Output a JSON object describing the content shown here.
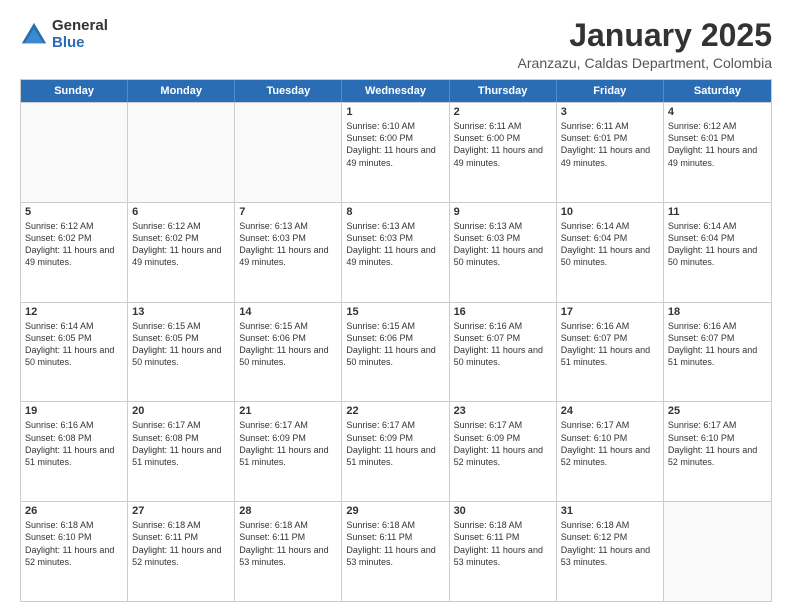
{
  "logo": {
    "general": "General",
    "blue": "Blue"
  },
  "title": "January 2025",
  "subtitle": "Aranzazu, Caldas Department, Colombia",
  "header_days": [
    "Sunday",
    "Monday",
    "Tuesday",
    "Wednesday",
    "Thursday",
    "Friday",
    "Saturday"
  ],
  "weeks": [
    [
      {
        "day": "",
        "empty": true
      },
      {
        "day": "",
        "empty": true
      },
      {
        "day": "",
        "empty": true
      },
      {
        "day": "1",
        "text": "Sunrise: 6:10 AM\nSunset: 6:00 PM\nDaylight: 11 hours\nand 49 minutes."
      },
      {
        "day": "2",
        "text": "Sunrise: 6:11 AM\nSunset: 6:00 PM\nDaylight: 11 hours\nand 49 minutes."
      },
      {
        "day": "3",
        "text": "Sunrise: 6:11 AM\nSunset: 6:01 PM\nDaylight: 11 hours\nand 49 minutes."
      },
      {
        "day": "4",
        "text": "Sunrise: 6:12 AM\nSunset: 6:01 PM\nDaylight: 11 hours\nand 49 minutes."
      }
    ],
    [
      {
        "day": "5",
        "text": "Sunrise: 6:12 AM\nSunset: 6:02 PM\nDaylight: 11 hours\nand 49 minutes."
      },
      {
        "day": "6",
        "text": "Sunrise: 6:12 AM\nSunset: 6:02 PM\nDaylight: 11 hours\nand 49 minutes."
      },
      {
        "day": "7",
        "text": "Sunrise: 6:13 AM\nSunset: 6:03 PM\nDaylight: 11 hours\nand 49 minutes."
      },
      {
        "day": "8",
        "text": "Sunrise: 6:13 AM\nSunset: 6:03 PM\nDaylight: 11 hours\nand 49 minutes."
      },
      {
        "day": "9",
        "text": "Sunrise: 6:13 AM\nSunset: 6:03 PM\nDaylight: 11 hours\nand 50 minutes."
      },
      {
        "day": "10",
        "text": "Sunrise: 6:14 AM\nSunset: 6:04 PM\nDaylight: 11 hours\nand 50 minutes."
      },
      {
        "day": "11",
        "text": "Sunrise: 6:14 AM\nSunset: 6:04 PM\nDaylight: 11 hours\nand 50 minutes."
      }
    ],
    [
      {
        "day": "12",
        "text": "Sunrise: 6:14 AM\nSunset: 6:05 PM\nDaylight: 11 hours\nand 50 minutes."
      },
      {
        "day": "13",
        "text": "Sunrise: 6:15 AM\nSunset: 6:05 PM\nDaylight: 11 hours\nand 50 minutes."
      },
      {
        "day": "14",
        "text": "Sunrise: 6:15 AM\nSunset: 6:06 PM\nDaylight: 11 hours\nand 50 minutes."
      },
      {
        "day": "15",
        "text": "Sunrise: 6:15 AM\nSunset: 6:06 PM\nDaylight: 11 hours\nand 50 minutes."
      },
      {
        "day": "16",
        "text": "Sunrise: 6:16 AM\nSunset: 6:07 PM\nDaylight: 11 hours\nand 50 minutes."
      },
      {
        "day": "17",
        "text": "Sunrise: 6:16 AM\nSunset: 6:07 PM\nDaylight: 11 hours\nand 51 minutes."
      },
      {
        "day": "18",
        "text": "Sunrise: 6:16 AM\nSunset: 6:07 PM\nDaylight: 11 hours\nand 51 minutes."
      }
    ],
    [
      {
        "day": "19",
        "text": "Sunrise: 6:16 AM\nSunset: 6:08 PM\nDaylight: 11 hours\nand 51 minutes."
      },
      {
        "day": "20",
        "text": "Sunrise: 6:17 AM\nSunset: 6:08 PM\nDaylight: 11 hours\nand 51 minutes."
      },
      {
        "day": "21",
        "text": "Sunrise: 6:17 AM\nSunset: 6:09 PM\nDaylight: 11 hours\nand 51 minutes."
      },
      {
        "day": "22",
        "text": "Sunrise: 6:17 AM\nSunset: 6:09 PM\nDaylight: 11 hours\nand 51 minutes."
      },
      {
        "day": "23",
        "text": "Sunrise: 6:17 AM\nSunset: 6:09 PM\nDaylight: 11 hours\nand 52 minutes."
      },
      {
        "day": "24",
        "text": "Sunrise: 6:17 AM\nSunset: 6:10 PM\nDaylight: 11 hours\nand 52 minutes."
      },
      {
        "day": "25",
        "text": "Sunrise: 6:17 AM\nSunset: 6:10 PM\nDaylight: 11 hours\nand 52 minutes."
      }
    ],
    [
      {
        "day": "26",
        "text": "Sunrise: 6:18 AM\nSunset: 6:10 PM\nDaylight: 11 hours\nand 52 minutes."
      },
      {
        "day": "27",
        "text": "Sunrise: 6:18 AM\nSunset: 6:11 PM\nDaylight: 11 hours\nand 52 minutes."
      },
      {
        "day": "28",
        "text": "Sunrise: 6:18 AM\nSunset: 6:11 PM\nDaylight: 11 hours\nand 53 minutes."
      },
      {
        "day": "29",
        "text": "Sunrise: 6:18 AM\nSunset: 6:11 PM\nDaylight: 11 hours\nand 53 minutes."
      },
      {
        "day": "30",
        "text": "Sunrise: 6:18 AM\nSunset: 6:11 PM\nDaylight: 11 hours\nand 53 minutes."
      },
      {
        "day": "31",
        "text": "Sunrise: 6:18 AM\nSunset: 6:12 PM\nDaylight: 11 hours\nand 53 minutes."
      },
      {
        "day": "",
        "empty": true
      }
    ]
  ]
}
